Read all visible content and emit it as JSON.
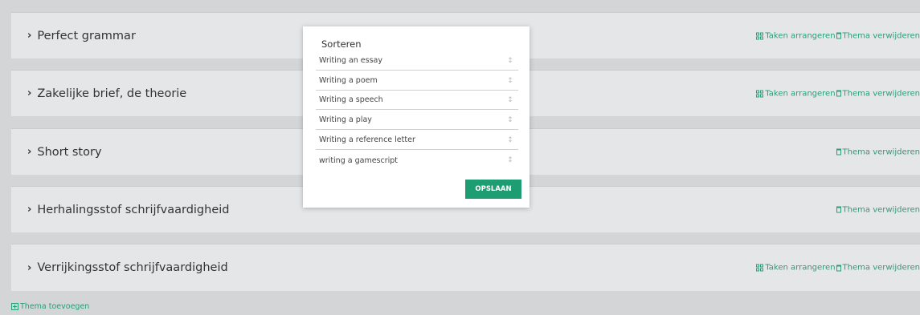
{
  "themes": [
    {
      "title": "Perfect grammar",
      "arrange_label": "Taken arrangeren",
      "delete_label": "Thema verwijderen"
    },
    {
      "title": "Zakelijke brief, de theorie",
      "arrange_label": "Taken arrangeren",
      "delete_label": "Thema verwijderen"
    },
    {
      "title": "Short story",
      "delete_label": "Thema verwijderen"
    },
    {
      "title": "Herhalingsstof schrijfvaardigheid",
      "delete_label": "Thema verwijderen"
    },
    {
      "title": "Verrijkingsstof schrijfvaardigheid",
      "arrange_label": "Taken arrangeren",
      "delete_label": "Thema verwijderen"
    }
  ],
  "sort_modal": {
    "title": "Sorteren",
    "items": [
      "Writing an essay",
      "Writing a poem",
      "Writing a speech",
      "Writing a play",
      "Writing a reference letter",
      "writing a gamescript"
    ],
    "save_label": "OPSLAAN"
  },
  "add_theme_label": "Thema toevoegen",
  "colors": {
    "accent": "#2a9d77",
    "button": "#1f9d72",
    "panel": "#e4e6e8",
    "background": "#d3d5d7"
  },
  "icons": {
    "arrange": "grid-icon",
    "delete": "trash-icon",
    "add": "plus-square-icon",
    "expand": "chevron-right-icon",
    "drag": "drag-handle-icon"
  }
}
